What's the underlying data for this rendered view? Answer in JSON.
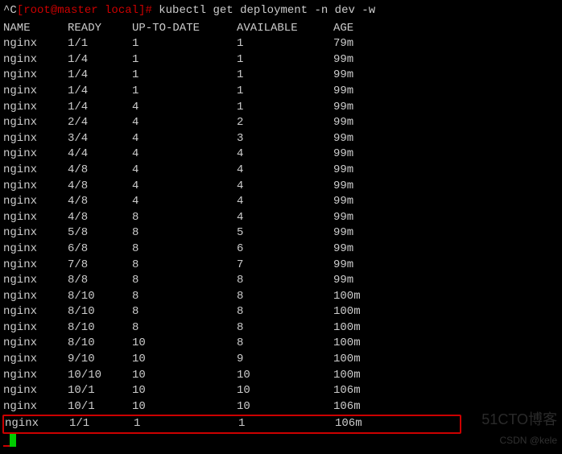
{
  "prompt": {
    "ctrl": "^C",
    "user_host": "[root@master local]# ",
    "command": "kubectl get deployment -n dev -w"
  },
  "headers": {
    "name": "NAME",
    "ready": "READY",
    "uptodate": "UP-TO-DATE",
    "available": "AVAILABLE",
    "age": "AGE"
  },
  "rows": [
    {
      "name": "nginx",
      "ready": "1/1",
      "uptodate": "1",
      "available": "1",
      "age": "79m"
    },
    {
      "name": "nginx",
      "ready": "1/4",
      "uptodate": "1",
      "available": "1",
      "age": "99m"
    },
    {
      "name": "nginx",
      "ready": "1/4",
      "uptodate": "1",
      "available": "1",
      "age": "99m"
    },
    {
      "name": "nginx",
      "ready": "1/4",
      "uptodate": "1",
      "available": "1",
      "age": "99m"
    },
    {
      "name": "nginx",
      "ready": "1/4",
      "uptodate": "4",
      "available": "1",
      "age": "99m"
    },
    {
      "name": "nginx",
      "ready": "2/4",
      "uptodate": "4",
      "available": "2",
      "age": "99m"
    },
    {
      "name": "nginx",
      "ready": "3/4",
      "uptodate": "4",
      "available": "3",
      "age": "99m"
    },
    {
      "name": "nginx",
      "ready": "4/4",
      "uptodate": "4",
      "available": "4",
      "age": "99m"
    },
    {
      "name": "nginx",
      "ready": "4/8",
      "uptodate": "4",
      "available": "4",
      "age": "99m"
    },
    {
      "name": "nginx",
      "ready": "4/8",
      "uptodate": "4",
      "available": "4",
      "age": "99m"
    },
    {
      "name": "nginx",
      "ready": "4/8",
      "uptodate": "4",
      "available": "4",
      "age": "99m"
    },
    {
      "name": "nginx",
      "ready": "4/8",
      "uptodate": "8",
      "available": "4",
      "age": "99m"
    },
    {
      "name": "nginx",
      "ready": "5/8",
      "uptodate": "8",
      "available": "5",
      "age": "99m"
    },
    {
      "name": "nginx",
      "ready": "6/8",
      "uptodate": "8",
      "available": "6",
      "age": "99m"
    },
    {
      "name": "nginx",
      "ready": "7/8",
      "uptodate": "8",
      "available": "7",
      "age": "99m"
    },
    {
      "name": "nginx",
      "ready": "8/8",
      "uptodate": "8",
      "available": "8",
      "age": "99m"
    },
    {
      "name": "nginx",
      "ready": "8/10",
      "uptodate": "8",
      "available": "8",
      "age": "100m"
    },
    {
      "name": "nginx",
      "ready": "8/10",
      "uptodate": "8",
      "available": "8",
      "age": "100m"
    },
    {
      "name": "nginx",
      "ready": "8/10",
      "uptodate": "8",
      "available": "8",
      "age": "100m"
    },
    {
      "name": "nginx",
      "ready": "8/10",
      "uptodate": "10",
      "available": "8",
      "age": "100m"
    },
    {
      "name": "nginx",
      "ready": "9/10",
      "uptodate": "10",
      "available": "9",
      "age": "100m"
    },
    {
      "name": "nginx",
      "ready": "10/10",
      "uptodate": "10",
      "available": "10",
      "age": "100m"
    },
    {
      "name": "nginx",
      "ready": "10/1",
      "uptodate": "10",
      "available": "10",
      "age": "106m"
    },
    {
      "name": "nginx",
      "ready": "10/1",
      "uptodate": "10",
      "available": "10",
      "age": "106m"
    }
  ],
  "highlight_row": {
    "name": "nginx",
    "ready": "1/1",
    "uptodate": "1",
    "available": "1",
    "age": "106m"
  },
  "watermark1": "51CTO博客",
  "watermark2": "CSDN @kele"
}
